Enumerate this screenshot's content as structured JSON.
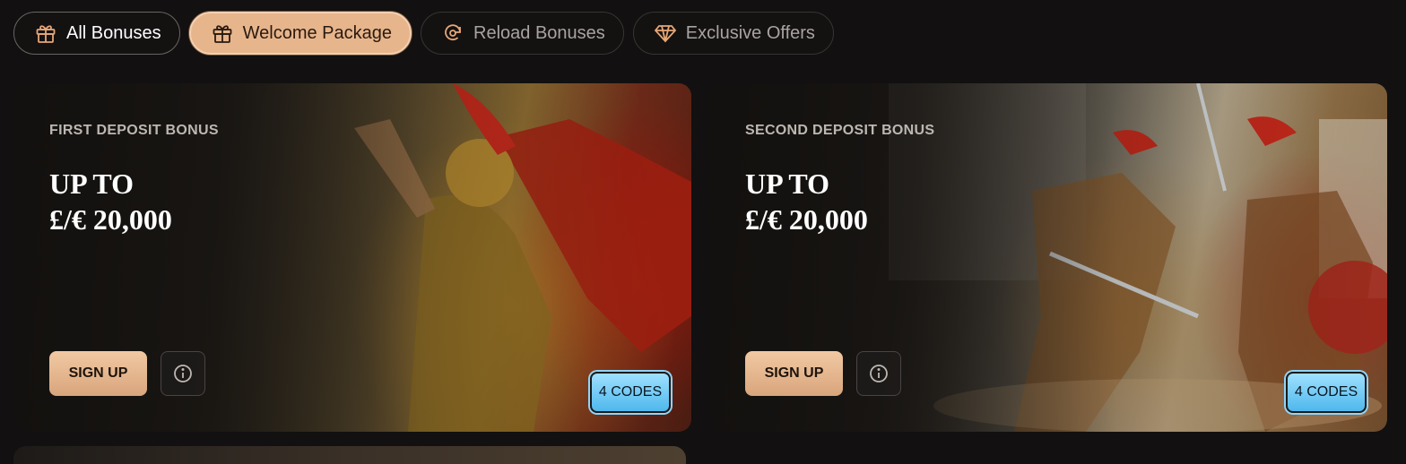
{
  "tabs": [
    {
      "label": "All Bonuses",
      "icon": "gift-icon"
    },
    {
      "label": "Welcome Package",
      "icon": "gift-icon",
      "active": true
    },
    {
      "label": "Reload Bonuses",
      "icon": "reload-icon"
    },
    {
      "label": "Exclusive Offers",
      "icon": "diamond-icon"
    }
  ],
  "cards": [
    {
      "eyebrow": "FIRST DEPOSIT BONUS",
      "headline_line1": "UP TO",
      "headline_line2": "£/€ 20,000",
      "signup_label": "SIGN UP",
      "codes_label": "4 CODES"
    },
    {
      "eyebrow": "SECOND DEPOSIT BONUS",
      "headline_line1": "UP TO",
      "headline_line2": "£/€ 20,000",
      "signup_label": "SIGN UP",
      "codes_label": "4 CODES"
    }
  ],
  "colors": {
    "accent": "#e7b58c",
    "codes": "#6cc9f3",
    "background": "#121010"
  }
}
